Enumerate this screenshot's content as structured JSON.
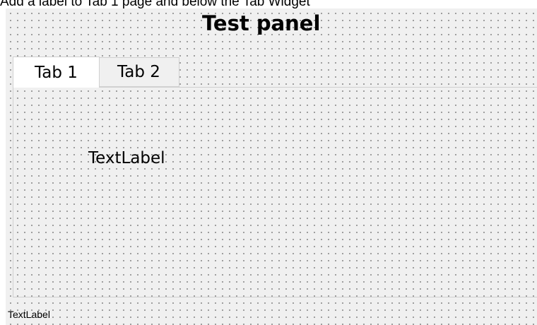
{
  "instruction": "Add a label to Tab 1 page and below the Tab Widget",
  "panel": {
    "title": "Test panel"
  },
  "tabs": [
    {
      "label": "Tab 1",
      "selected": true
    },
    {
      "label": "Tab 2",
      "selected": false
    }
  ],
  "tab1_page": {
    "label_text": "TextLabel"
  },
  "below_tab_widget": {
    "label_text": "TextLabel"
  }
}
